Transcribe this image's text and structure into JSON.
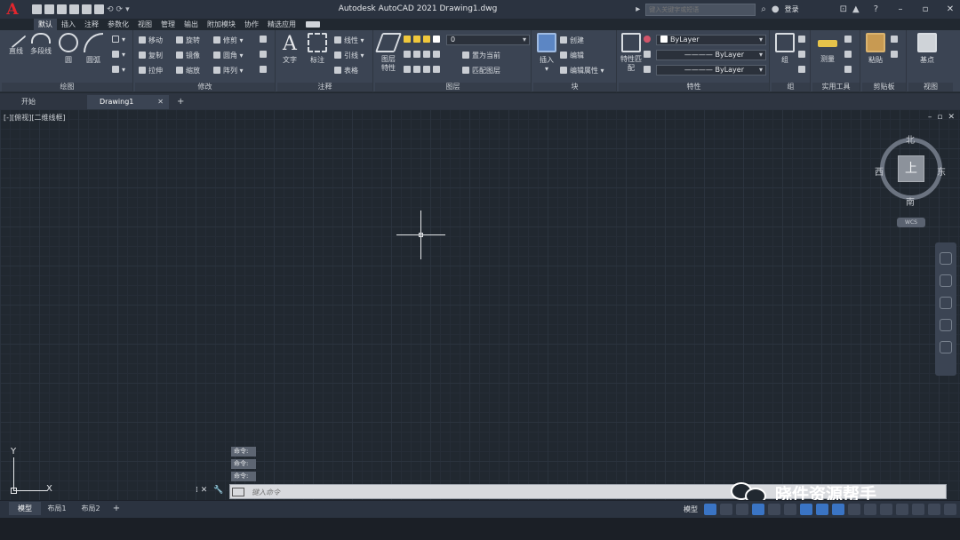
{
  "titlebar": {
    "app_logo": "A",
    "title": "Autodesk AutoCAD 2021    Drawing1.dwg",
    "search_placeholder": "键入关键字或短语",
    "login_label": "登录"
  },
  "ribbon_tabs": [
    "默认",
    "插入",
    "注释",
    "参数化",
    "视图",
    "管理",
    "输出",
    "附加模块",
    "协作",
    "精选应用"
  ],
  "panels": {
    "draw": {
      "label": "绘图",
      "tools": [
        "直线",
        "多段线",
        "圆",
        "圆弧"
      ]
    },
    "modify": {
      "label": "修改",
      "tools": [
        "移动",
        "旋转",
        "修剪",
        "复制",
        "镜像",
        "圆角",
        "拉伸",
        "缩放",
        "阵列"
      ]
    },
    "annotation": {
      "label": "注释",
      "tools": [
        "文字",
        "标注",
        "线性",
        "引线",
        "表格"
      ]
    },
    "layers": {
      "label": "图层",
      "tools": [
        "图层特性",
        "置为当前",
        "匹配图层"
      ],
      "current_layer": "0"
    },
    "block": {
      "label": "块",
      "tools": [
        "插入",
        "创建",
        "编辑",
        "编辑属性"
      ]
    },
    "properties": {
      "label": "特性",
      "tools": [
        "特性匹配"
      ],
      "color": "ByLayer",
      "linetype": "ByLayer",
      "lineweight": "ByLayer"
    },
    "groups": {
      "label": "组",
      "tools": [
        "组"
      ]
    },
    "utilities": {
      "label": "实用工具",
      "tools": [
        "测量"
      ]
    },
    "clipboard": {
      "label": "剪贴板",
      "tools": [
        "粘贴"
      ]
    },
    "view": {
      "label": "视图",
      "tools": [
        "基点"
      ]
    }
  },
  "file_tabs": {
    "start": "开始",
    "drawing": "Drawing1"
  },
  "canvas": {
    "view_label": "[-][俯视][二维线框]",
    "viewcube": {
      "north": "北",
      "south": "南",
      "east": "东",
      "west": "西",
      "face": "上",
      "wcs": "WCS"
    },
    "ucs": {
      "x": "X",
      "y": "Y"
    }
  },
  "command": {
    "history": [
      "命令:",
      "命令:",
      "命令:"
    ],
    "placeholder": "键入命令"
  },
  "watermark": "晓件资源帮手",
  "layout_tabs": [
    "模型",
    "布局1",
    "布局2"
  ],
  "status": {
    "model_label": "模型"
  },
  "colors": {
    "canvas_bg": "#212830",
    "ribbon_bg": "#3b4453",
    "logo_red": "#e2262d",
    "status_active": "#3a74c4"
  }
}
